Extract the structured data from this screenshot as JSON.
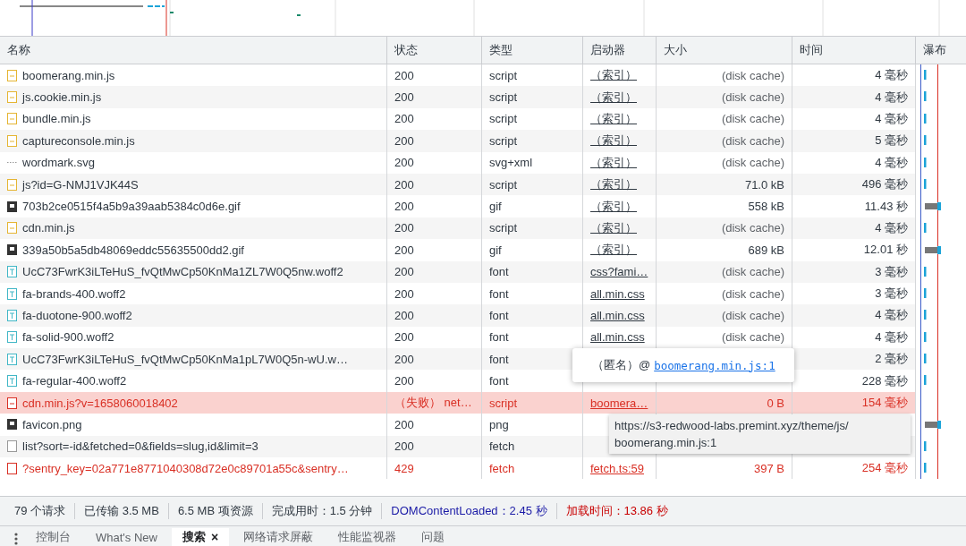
{
  "columns": [
    {
      "label": "名称"
    },
    {
      "label": "状态"
    },
    {
      "label": "类型"
    },
    {
      "label": "启动器"
    },
    {
      "label": "大小"
    },
    {
      "label": "时间"
    },
    {
      "label": "瀑布"
    }
  ],
  "rows": [
    {
      "kind": "script",
      "name": "boomerang.min.js",
      "status": "200",
      "type": "script",
      "initiator": "（索引）",
      "size": "(disk cache)",
      "time": "4 毫秒",
      "failed": false,
      "error": false
    },
    {
      "kind": "script",
      "name": "js.cookie.min.js",
      "status": "200",
      "type": "script",
      "initiator": "（索引）",
      "size": "(disk cache)",
      "time": "4 毫秒",
      "failed": false,
      "error": false
    },
    {
      "kind": "script",
      "name": "bundle.min.js",
      "status": "200",
      "type": "script",
      "initiator": "（索引）",
      "size": "(disk cache)",
      "time": "4 毫秒",
      "failed": false,
      "error": false
    },
    {
      "kind": "script",
      "name": "captureconsole.min.js",
      "status": "200",
      "type": "script",
      "initiator": "（索引）",
      "size": "(disk cache)",
      "time": "5 毫秒",
      "failed": false,
      "error": false
    },
    {
      "kind": "svg",
      "name": "wordmark.svg",
      "status": "200",
      "type": "svg+xml",
      "initiator": "（索引）",
      "size": "(disk cache)",
      "time": "4 毫秒",
      "failed": false,
      "error": false
    },
    {
      "kind": "script",
      "name": "js?id=G-NMJ1VJK44S",
      "status": "200",
      "type": "script",
      "initiator": "（索引）",
      "size": "71.0 kB",
      "time": "496 毫秒",
      "failed": false,
      "error": false
    },
    {
      "kind": "image",
      "name": "703b2ce0515f4a5b9a39aab5384c0d6e.gif",
      "status": "200",
      "type": "gif",
      "initiator": "（索引）",
      "size": "558 kB",
      "time": "11.43 秒",
      "failed": false,
      "error": false
    },
    {
      "kind": "script",
      "name": "cdn.min.js",
      "status": "200",
      "type": "script",
      "initiator": "（索引）",
      "size": "(disk cache)",
      "time": "4 毫秒",
      "failed": false,
      "error": false
    },
    {
      "kind": "image",
      "name": "339a50b5a5db48069eddc55635500dd2.gif",
      "status": "200",
      "type": "gif",
      "initiator": "（索引）",
      "size": "689 kB",
      "time": "12.01 秒",
      "failed": false,
      "error": false
    },
    {
      "kind": "font",
      "name": "UcC73FwrK3iLTeHuS_fvQtMwCp50KnMa1ZL7W0Q5nw.woff2",
      "status": "200",
      "type": "font",
      "initiator": "css?fami…",
      "size": "(disk cache)",
      "time": "3 毫秒",
      "failed": false,
      "error": false
    },
    {
      "kind": "font",
      "name": "fa-brands-400.woff2",
      "status": "200",
      "type": "font",
      "initiator": "all.min.css",
      "size": "(disk cache)",
      "time": "3 毫秒",
      "failed": false,
      "error": false
    },
    {
      "kind": "font",
      "name": "fa-duotone-900.woff2",
      "status": "200",
      "type": "font",
      "initiator": "all.min.css",
      "size": "(disk cache)",
      "time": "4 毫秒",
      "failed": false,
      "error": false
    },
    {
      "kind": "font",
      "name": "fa-solid-900.woff2",
      "status": "200",
      "type": "font",
      "initiator": "all.min.css",
      "size": "(disk cache)",
      "time": "4 毫秒",
      "failed": false,
      "error": false
    },
    {
      "kind": "font",
      "name": "UcC73FwrK3iLTeHuS_fvQtMwCp50KnMa1pL7W0Q5n-wU.w…",
      "status": "200",
      "type": "font",
      "time": "2 毫秒",
      "failed": false,
      "error": false
    },
    {
      "kind": "font",
      "name": "fa-regular-400.woff2",
      "status": "200",
      "type": "font",
      "time": "228 毫秒",
      "failed": false,
      "error": false
    },
    {
      "kind": "script",
      "name": "cdn.min.js?v=1658060018402",
      "status": "（失败） net…",
      "type": "script",
      "initiator": "boomera…",
      "size": "0 B",
      "time": "154 毫秒",
      "failed": true,
      "error": true
    },
    {
      "kind": "image",
      "name": "favicon.png",
      "status": "200",
      "type": "png",
      "failed": false,
      "error": false
    },
    {
      "kind": "fetch",
      "name": "list?sort=-id&fetched=0&fields=slug,id&limit=3",
      "status": "200",
      "type": "fetch",
      "failed": false,
      "error": false
    },
    {
      "kind": "fetch",
      "name": "?sentry_key=02a771e8771040308d72e0c89701a55c&sentry…",
      "status": "429",
      "type": "fetch",
      "initiator": "fetch.ts:59",
      "size": "397 B",
      "time": "254 毫秒",
      "failed": false,
      "error": true
    }
  ],
  "initiator_popup": {
    "prefix": "（匿名）@",
    "link": "boomerang.min.js:1"
  },
  "url_tooltip": "https://s3-redwood-labs.premint.xyz/theme/js/\nboomerang.min.js:1",
  "status_bar": [
    {
      "text": "79 个请求",
      "kind": "plain"
    },
    {
      "text": "已传输 3.5 MB",
      "kind": "plain"
    },
    {
      "text": "6.5 MB 项资源",
      "kind": "plain"
    },
    {
      "text": "完成用时：1.5 分钟",
      "kind": "plain"
    },
    {
      "text": "DOMContentLoaded：2.45 秒",
      "kind": "dom"
    },
    {
      "text": "加载时间：13.86 秒",
      "kind": "load"
    }
  ],
  "drawer_tabs": [
    {
      "label": "控制台",
      "selected": false,
      "closable": false
    },
    {
      "label": "What's New",
      "selected": false,
      "closable": false
    },
    {
      "label": "搜索",
      "selected": true,
      "closable": true
    },
    {
      "label": "网络请求屏蔽",
      "selected": false,
      "closable": false
    },
    {
      "label": "性能监视器",
      "selected": false,
      "closable": false
    },
    {
      "label": "问题",
      "selected": false,
      "closable": false
    }
  ],
  "close_glyph": "×"
}
